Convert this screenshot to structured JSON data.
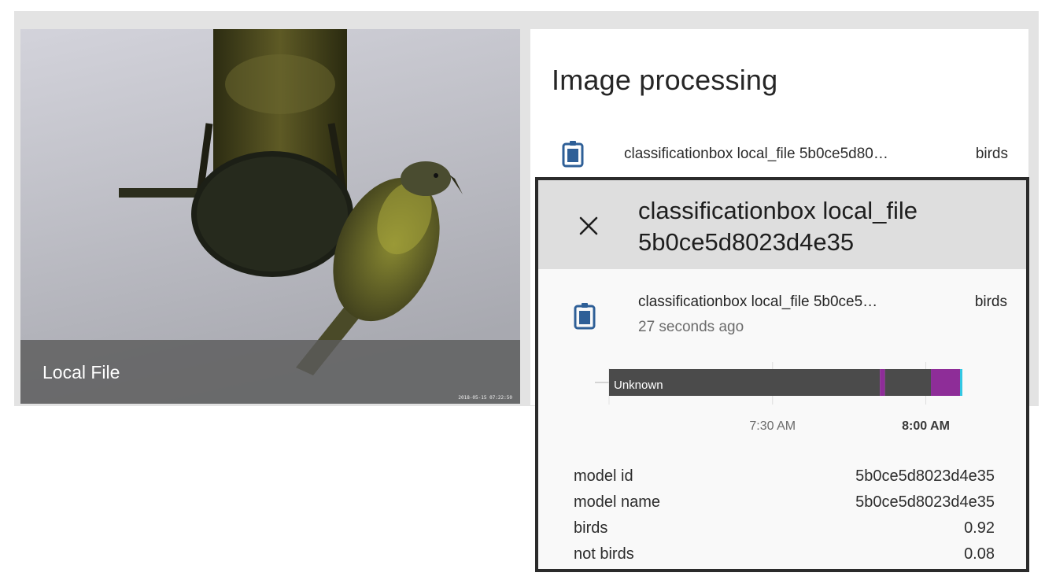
{
  "camera": {
    "name": "Local File",
    "timestamp": "2018-05-15 07:22:50"
  },
  "panel": {
    "title": "Image processing",
    "entity": {
      "icon": "clipboard-icon",
      "name": "classificationbox local_file 5b0ce5d80…",
      "state": "birds"
    }
  },
  "dialog": {
    "close_icon": "close-icon",
    "title": "classificationbox local_file 5b0ce5d8023d4e35",
    "entity": {
      "icon": "clipboard-icon",
      "name": "classificationbox local_file 5b0ce5…",
      "state": "birds",
      "last_changed": "27 seconds ago"
    },
    "timeline": {
      "state_label": "Unknown",
      "ticks": [
        "7:30 AM",
        "8:00 AM"
      ],
      "colors": {
        "unknown": "#4b4b4b",
        "birds": "#8e2d98",
        "marker": "#33c7e3"
      },
      "segments": [
        {
          "state": "Unknown",
          "start": "06:58",
          "end": "07:51"
        },
        {
          "state": "birds",
          "start": "07:51",
          "end": "07:52"
        },
        {
          "state": "Unknown",
          "start": "07:52",
          "end": "08:01"
        },
        {
          "state": "marker",
          "start": "08:01",
          "end": "08:01"
        },
        {
          "state": "birds",
          "start": "08:01",
          "end": "08:07"
        }
      ]
    },
    "attributes": [
      {
        "key": "model id",
        "value": "5b0ce5d8023d4e35"
      },
      {
        "key": "model name",
        "value": "5b0ce5d8023d4e35"
      },
      {
        "key": "birds",
        "value": "0.92"
      },
      {
        "key": "not birds",
        "value": "0.08"
      }
    ]
  },
  "colors": {
    "icon_blue": "#2e5f97",
    "dialog_border": "#2b2b2b",
    "header_gray": "#dedede"
  }
}
